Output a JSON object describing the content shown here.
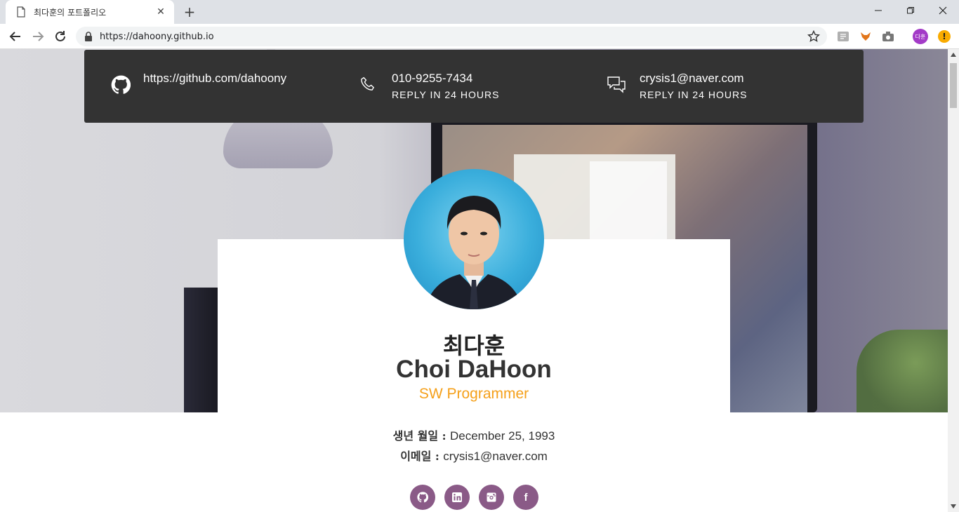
{
  "browser": {
    "tab_title": "최다훈의 포트폴리오",
    "url": "https://dahoony.github.io",
    "profile_initials": "다훈"
  },
  "contact": {
    "github": {
      "main": "https://github.com/dahoony",
      "icon": "github-icon"
    },
    "phone": {
      "main": "010-9255-7434",
      "sub": "REPLY IN 24 HOURS",
      "icon": "phone-icon"
    },
    "email": {
      "main": "crysis1@naver.com",
      "sub": "REPLY IN 24 HOURS",
      "icon": "chat-icon"
    }
  },
  "profile": {
    "name_kr": "최다훈",
    "name_en": "Choi DaHoon",
    "role": "SW Programmer",
    "birth_label": "생년 월일 :",
    "birth_value": "December 25, 1993",
    "email_label": "이메일 :",
    "email_value": "crysis1@naver.com"
  },
  "socials": [
    {
      "name": "github",
      "glyph": ""
    },
    {
      "name": "linkedin",
      "glyph": "in"
    },
    {
      "name": "instagram",
      "glyph": ""
    },
    {
      "name": "facebook",
      "glyph": "f"
    }
  ],
  "colors": {
    "contact_bar": "#333333",
    "accent": "#f5a01a",
    "social": "#8a5a87",
    "profile_badge": "#a33bc7",
    "alert_badge": "#f9ab00"
  }
}
